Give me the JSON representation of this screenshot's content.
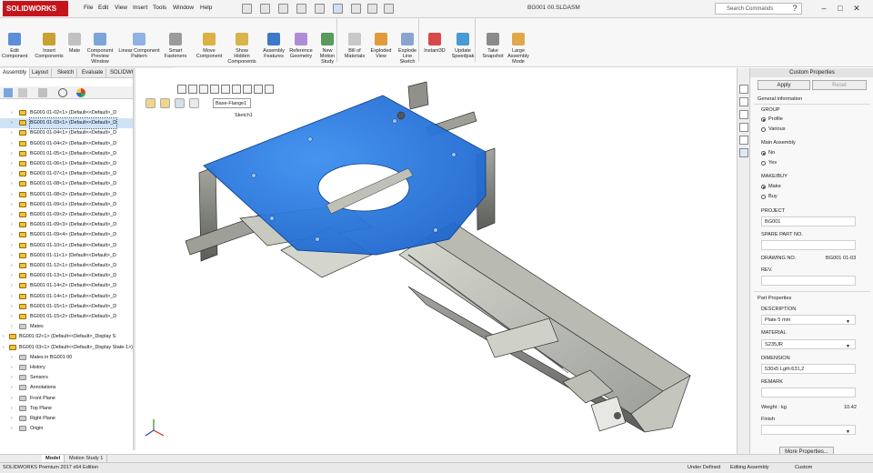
{
  "app": {
    "logo": "SOLIDWORKS",
    "menu": [
      "File",
      "Edit",
      "View",
      "Insert",
      "Tools",
      "Window",
      "Help"
    ],
    "document_title": "BG001 00.SLDASM",
    "search_placeholder": "Search Commands",
    "window_controls": [
      "?",
      "–",
      "□",
      "✕"
    ]
  },
  "ribbon": {
    "buttons": [
      {
        "label": "Edit\nComponent",
        "color": "#5b8fd6"
      },
      {
        "label": "Insert\nComponents",
        "color": "#c8a131"
      },
      {
        "label": "Mate",
        "color": "#c1c1c1"
      },
      {
        "label": "Component\nPreview\nWindow",
        "color": "#7aa6d8"
      },
      {
        "label": "Linear Component\nPattern",
        "color": "#8fb3e3"
      },
      {
        "label": "Smart\nFasteners",
        "color": "#9b9b9b"
      },
      {
        "label": "Move\nComponent",
        "color": "#dcb042"
      },
      {
        "label": "Show\nHidden\nComponents",
        "color": "#d8b54a"
      },
      {
        "label": "Assembly\nFeatures",
        "color": "#3f78c7"
      },
      {
        "label": "Reference\nGeometry",
        "color": "#b08cd8"
      },
      {
        "label": "New\nMotion\nStudy",
        "color": "#5a9a5a"
      },
      {
        "label": "Bill of\nMaterials",
        "color": "#c8c8c8"
      },
      {
        "label": "Exploded\nView",
        "color": "#e19b3a"
      },
      {
        "label": "Explode\nLine\nSketch",
        "color": "#8aa4d0"
      },
      {
        "label": "Instant3D",
        "color": "#d84a4a"
      },
      {
        "label": "Update\nSpeedpak",
        "color": "#4a9ad8"
      },
      {
        "label": "Take\nSnapshot",
        "color": "#8b8b8b"
      },
      {
        "label": "Large\nAssembly\nMode",
        "color": "#e0a84a"
      }
    ]
  },
  "command_tabs": [
    "Assembly",
    "Layout",
    "Sketch",
    "Evaluate",
    "SOLIDWORKS Add-Ins"
  ],
  "tree": {
    "items": [
      {
        "label": "BG001 01-02<1> (Default<<Default>_D",
        "type": "part",
        "selected": false
      },
      {
        "label": "BG001 01-03<1> (Default<<Default>_D",
        "type": "part",
        "selected": true
      },
      {
        "label": "BG001 01-04<1> (Default<<Default>_D",
        "type": "part",
        "selected": false
      },
      {
        "label": "BG001 01-04<2> (Default<<Default>_D",
        "type": "part",
        "selected": false
      },
      {
        "label": "BG001 01-05<1> (Default<<Default>_D",
        "type": "part",
        "selected": false
      },
      {
        "label": "BG001 01-06<1> (Default<<Default>_D",
        "type": "part",
        "selected": false
      },
      {
        "label": "BG001 01-07<1> (Default<<Default>_D",
        "type": "part",
        "selected": false
      },
      {
        "label": "BG001 01-08<1> (Default<<Default>_D",
        "type": "part",
        "selected": false
      },
      {
        "label": "BG001 01-08<2> (Default<<Default>_D",
        "type": "part",
        "selected": false
      },
      {
        "label": "BG001 01-09<1> (Default<<Default>_D",
        "type": "part",
        "selected": false
      },
      {
        "label": "BG001 01-09<2> (Default<<Default>_D",
        "type": "part",
        "selected": false
      },
      {
        "label": "BG001 01-09<3> (Default<<Default>_D",
        "type": "part",
        "selected": false
      },
      {
        "label": "BG001 01-09<4> (Default<<Default>_D",
        "type": "part",
        "selected": false
      },
      {
        "label": "BG001 01-10<1> (Default<<Default>_D",
        "type": "part",
        "selected": false
      },
      {
        "label": "BG001 01-11<1> (Default<<Default>_D",
        "type": "part",
        "selected": false
      },
      {
        "label": "BG001 01-12<1> (Default<<Default>_D",
        "type": "part",
        "selected": false
      },
      {
        "label": "BG001 01-13<1> (Default<<Default>_D",
        "type": "part",
        "selected": false
      },
      {
        "label": "BG001 01-14<2> (Default<<Default>_D",
        "type": "part",
        "selected": false
      },
      {
        "label": "BG001 01-14<1> (Default<<Default>_D",
        "type": "part",
        "selected": false
      },
      {
        "label": "BG001 01-15<1> (Default<<Default>_D",
        "type": "part",
        "selected": false
      },
      {
        "label": "BG001 01-15<2> (Default<<Default>_D",
        "type": "part",
        "selected": false
      },
      {
        "label": "Mates",
        "type": "sub",
        "selected": false
      },
      {
        "label": "BG001 02<1> (Default<<Default>_Display S",
        "type": "root",
        "selected": false
      },
      {
        "label": "BG001 03<1> (Default<<Default>_Display State-1>)",
        "type": "root",
        "selected": false
      },
      {
        "label": "Mates in BG001 00",
        "type": "sub",
        "selected": false
      },
      {
        "label": "History",
        "type": "sub",
        "selected": false
      },
      {
        "label": "Sensors",
        "type": "sub",
        "selected": false
      },
      {
        "label": "Annotations",
        "type": "sub",
        "selected": false
      },
      {
        "label": "Front Plane",
        "type": "sub",
        "selected": false
      },
      {
        "label": "Top Plane",
        "type": "sub",
        "selected": false
      },
      {
        "label": "Right Plane",
        "type": "sub",
        "selected": false
      },
      {
        "label": "Origin",
        "type": "sub",
        "selected": false
      }
    ]
  },
  "viewport": {
    "breadcrumb_label": "Base-Flange1",
    "sketch_label": "Sketch1",
    "highlight_color": "#1f6fd6"
  },
  "custom_properties": {
    "title": "Custom Properties",
    "apply": "Apply",
    "reset": "Reset",
    "general_header": "General information",
    "group_label": "GROUP",
    "group_options": [
      {
        "label": "Profile",
        "checked": true
      },
      {
        "label": "Various",
        "checked": false
      }
    ],
    "main_assembly_label": "Main Assembly",
    "main_assembly_options": [
      {
        "label": "No",
        "checked": true
      },
      {
        "label": "Yes",
        "checked": false
      }
    ],
    "make_buy_label": "MAKE/BUY",
    "make_buy_options": [
      {
        "label": "Make",
        "checked": true
      },
      {
        "label": "Buy",
        "checked": false
      }
    ],
    "project_label": "PROJECT",
    "project_value": "BG001",
    "spare_part_label": "SPARE PART NO.",
    "spare_part_value": "",
    "drawing_no_label": "DRAWING NO.",
    "drawing_no_value": "BG001 01-03",
    "rev_label": "REV.",
    "rev_value": "",
    "part_header": "Part Properties",
    "description_label": "DESCRIPTION",
    "description_value": "Plate 5 mm",
    "material_label": "MATERIAL",
    "material_value": "S235JR",
    "dimension_label": "DIMENSION",
    "dimension_value": "530x5 Lgth:631,2",
    "remark_label": "REMARK",
    "remark_value": "",
    "weight_label": "Weight : kg",
    "weight_value": "10.42",
    "finish_label": "Finish",
    "finish_value": "",
    "more_button": "More Properties..."
  },
  "bottom_tabs": [
    "Model",
    "Motion Study 1"
  ],
  "status": {
    "edition": "SOLIDWORKS Premium 2017 x64 Edition",
    "state": "Under Defined",
    "mode": "Editing Assembly",
    "units": "Custom"
  }
}
